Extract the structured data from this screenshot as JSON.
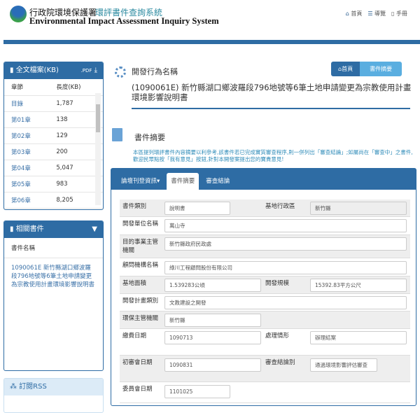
{
  "header": {
    "org": "行政院環境保護署",
    "system": "環評書件查詢系統",
    "english": "Environmental Impact Assessment  Inquiry System",
    "nav": [
      {
        "icon": "home-icon",
        "label": "首頁"
      },
      {
        "icon": "list-icon",
        "label": "導覽"
      },
      {
        "icon": "book-icon",
        "label": "手冊"
      }
    ]
  },
  "files_panel": {
    "title": "全文檔案(KB)",
    "pdf_label": ".PDF",
    "col_chapter": "章節",
    "col_size": "長度(KB)",
    "rows": [
      {
        "chapter": "目錄",
        "size": "1,787"
      },
      {
        "chapter": "第01章",
        "size": "138"
      },
      {
        "chapter": "第02章",
        "size": "129"
      },
      {
        "chapter": "第03章",
        "size": "200"
      },
      {
        "chapter": "第04章",
        "size": "5,047"
      },
      {
        "chapter": "第05章",
        "size": "983"
      },
      {
        "chapter": "第06章",
        "size": "8,205"
      }
    ]
  },
  "related_panel": {
    "title": "相關書件",
    "col": "書件名稱",
    "item": "1090061E 新竹縣湖口鄉波羅段796地號等6筆土地申請變更為宗教使用計畫環境影響說明書"
  },
  "rss_panel": {
    "title": "訂閱RSS"
  },
  "main": {
    "section_title": "開發行為名稱",
    "breadcrumb": [
      "首頁",
      "書件摘要"
    ],
    "project_title": "(1090061E) 新竹縣湖口鄉波羅段796地號等6筆土地申請變更為宗教使用計畫環境影響說明書",
    "summary_title": "書件摘要",
    "notice": "本區提列環評書件內容摘要以利參考,該書件若已完成實質審查程序,則一併列出「審查結論」;如屬尚在「審查中」之書件,歡迎民眾點按「我有意見」按鈕,針對本開發案提出您的寶貴意見!"
  },
  "tabs": [
    {
      "label": "論壇刊登資訊▾"
    },
    {
      "label": "書件摘要"
    },
    {
      "label": "審查結論"
    }
  ],
  "form": {
    "doc_type": {
      "label": "書件類別",
      "value": "說明書"
    },
    "district": {
      "label": "基地行政區",
      "value": "新竹縣"
    },
    "developer": {
      "label": "開發單位名稱",
      "value": "萬山寺"
    },
    "authority": {
      "label": "目的事業主管機關",
      "value": "新竹縣政府民政處"
    },
    "consultant": {
      "label": "顧問機構名稱",
      "value": "綠川工程顧問股份有限公司"
    },
    "area": {
      "label": "基地面積",
      "value": "1.539283公頃"
    },
    "scale": {
      "label": "開發規模",
      "value": "15392.83平方公尺"
    },
    "plan_type": {
      "label": "開發計畫類別",
      "value": "文教建設之開發"
    },
    "epa_authority": {
      "label": "環保主管機關",
      "value": "新竹縣"
    },
    "fee_date": {
      "label": "繳費日期",
      "value": "1090713"
    },
    "status": {
      "label": "處理情形",
      "value": "辦理結案"
    },
    "first_review": {
      "label": "初審會日期",
      "value": "1090831"
    },
    "conclusion": {
      "label": "審查結論別",
      "value": "通過環境影響評估審查"
    },
    "committee": {
      "label": "委員會日期",
      "value": "1101025"
    }
  }
}
